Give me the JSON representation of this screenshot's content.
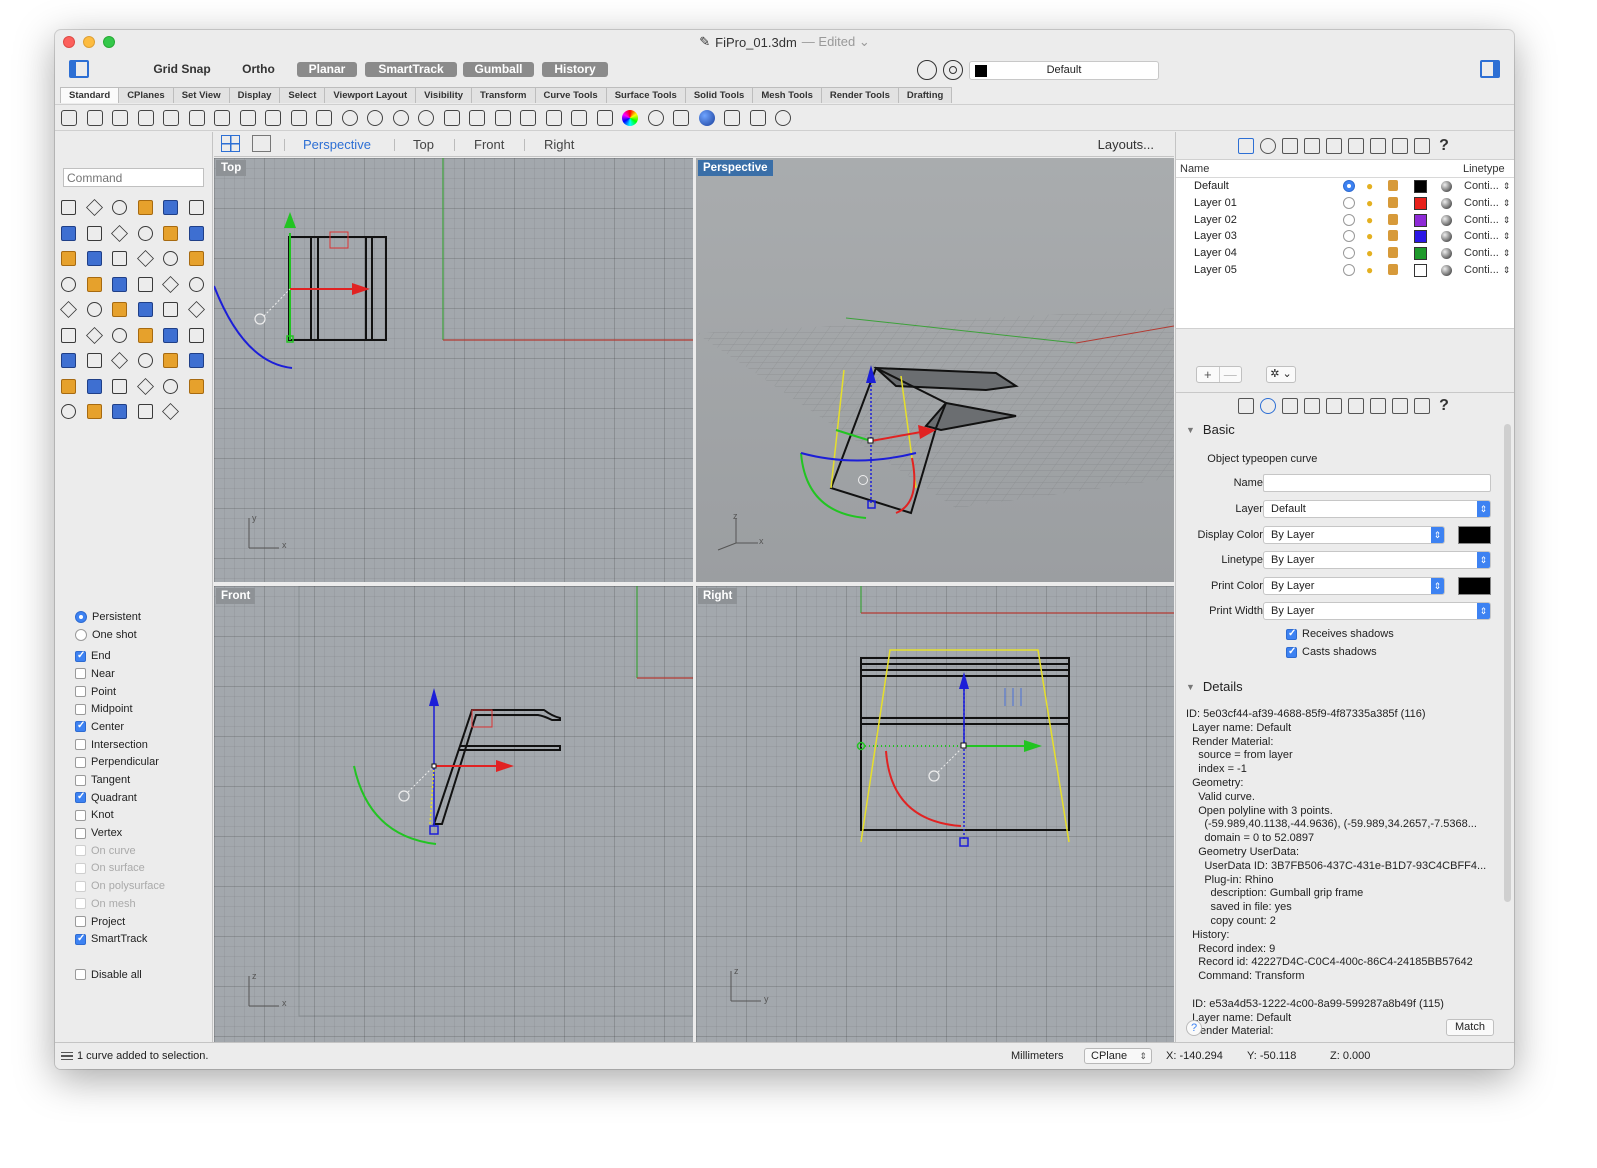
{
  "window": {
    "title": "FiPro_01.3dm",
    "title_status": "— Edited ⌄"
  },
  "snap_toolbar": {
    "grid_snap": "Grid Snap",
    "ortho": "Ortho",
    "planar": "Planar",
    "smarttrack": "SmartTrack",
    "gumball": "Gumball",
    "history": "History",
    "current_layer": "Default"
  },
  "tabs": [
    "Standard",
    "CPlanes",
    "Set View",
    "Display",
    "Select",
    "Viewport Layout",
    "Visibility",
    "Transform",
    "Curve Tools",
    "Surface Tools",
    "Solid Tools",
    "Mesh Tools",
    "Render Tools",
    "Drafting"
  ],
  "command": {
    "placeholder": "Command"
  },
  "viewport_tabs": [
    "Perspective",
    "Top",
    "Front",
    "Right"
  ],
  "layouts_button": "Layouts...",
  "viewports": {
    "top": {
      "label": "Top",
      "axis_v": "y",
      "axis_h": "x"
    },
    "perspective": {
      "label": "Perspective",
      "axis_v": "z",
      "axis_h": "x"
    },
    "front": {
      "label": "Front",
      "axis_v": "z",
      "axis_h": "x"
    },
    "right": {
      "label": "Right",
      "axis_v": "z",
      "axis_h": "y"
    }
  },
  "osnap_mode": {
    "persistent": "Persistent",
    "one_shot": "One shot"
  },
  "osnaps": [
    {
      "label": "End",
      "checked": true,
      "enabled": true
    },
    {
      "label": "Near",
      "checked": false,
      "enabled": true
    },
    {
      "label": "Point",
      "checked": false,
      "enabled": true
    },
    {
      "label": "Midpoint",
      "checked": false,
      "enabled": true
    },
    {
      "label": "Center",
      "checked": true,
      "enabled": true
    },
    {
      "label": "Intersection",
      "checked": false,
      "enabled": true
    },
    {
      "label": "Perpendicular",
      "checked": false,
      "enabled": true
    },
    {
      "label": "Tangent",
      "checked": false,
      "enabled": true
    },
    {
      "label": "Quadrant",
      "checked": true,
      "enabled": true
    },
    {
      "label": "Knot",
      "checked": false,
      "enabled": true
    },
    {
      "label": "Vertex",
      "checked": false,
      "enabled": true
    },
    {
      "label": "On curve",
      "checked": false,
      "enabled": false
    },
    {
      "label": "On surface",
      "checked": false,
      "enabled": false
    },
    {
      "label": "On polysurface",
      "checked": false,
      "enabled": false
    },
    {
      "label": "On mesh",
      "checked": false,
      "enabled": false
    },
    {
      "label": "Project",
      "checked": false,
      "enabled": true
    },
    {
      "label": "SmartTrack",
      "checked": true,
      "enabled": true
    }
  ],
  "disable_all": "Disable all",
  "layers_panel": {
    "col_name": "Name",
    "col_linetype": "Linetype",
    "layers": [
      {
        "name": "Default",
        "current": true,
        "color": "#000000",
        "linetype": "Conti..."
      },
      {
        "name": "Layer 01",
        "current": false,
        "color": "#e8211b",
        "linetype": "Conti..."
      },
      {
        "name": "Layer 02",
        "current": false,
        "color": "#8e2ad6",
        "linetype": "Conti..."
      },
      {
        "name": "Layer 03",
        "current": false,
        "color": "#2b17e6",
        "linetype": "Conti..."
      },
      {
        "name": "Layer 04",
        "current": false,
        "color": "#1f9a2b",
        "linetype": "Conti..."
      },
      {
        "name": "Layer 05",
        "current": false,
        "color": "#ffffff",
        "linetype": "Conti..."
      }
    ],
    "add": "+",
    "remove": "—",
    "gear": "✲ ⌄"
  },
  "properties": {
    "basic_heading": "Basic",
    "object_type_label": "Object type:",
    "object_type_value": "open curve",
    "name_label": "Name:",
    "layer_label": "Layer:",
    "layer_value": "Default",
    "display_color_label": "Display Color:",
    "display_color_value": "By Layer",
    "linetype_label": "Linetype:",
    "linetype_value": "By Layer",
    "print_color_label": "Print Color:",
    "print_color_value": "By Layer",
    "print_width_label": "Print Width:",
    "print_width_value": "By Layer",
    "receives_shadows": "Receives shadows",
    "casts_shadows": "Casts shadows",
    "details_heading": "Details",
    "details_text": "ID: 5e03cf44-af39-4688-85f9-4f87335a385f (116)\n  Layer name: Default\n  Render Material:\n    source = from layer\n    index = -1\n  Geometry:\n    Valid curve.\n    Open polyline with 3 points.\n      (-59.989,40.1138,-44.9636), (-59.989,34.2657,-7.5368...\n      domain = 0 to 52.0897\n    Geometry UserData:\n      UserData ID: 3B7FB506-437C-431e-B1D7-93C4CBFF4...\n      Plug-in: Rhino\n        description: Gumball grip frame\n        saved in file: yes\n        copy count: 2\n  History:\n    Record index: 9\n    Record id: 42227D4C-C0C4-400c-86C4-24185BB57642\n    Command: Transform\n\n  ID: e53a4d53-1222-4c00-8a99-599287a8b49f (115)\n  Layer name: Default\n  Render Material:\n    source = from layer",
    "help": "?",
    "match": "Match"
  },
  "status": {
    "message": "1 curve added to selection.",
    "units": "Millimeters",
    "cplane": "CPlane",
    "x": "X: -140.294",
    "y": "Y: -50.118",
    "z": "Z: 0.000"
  }
}
